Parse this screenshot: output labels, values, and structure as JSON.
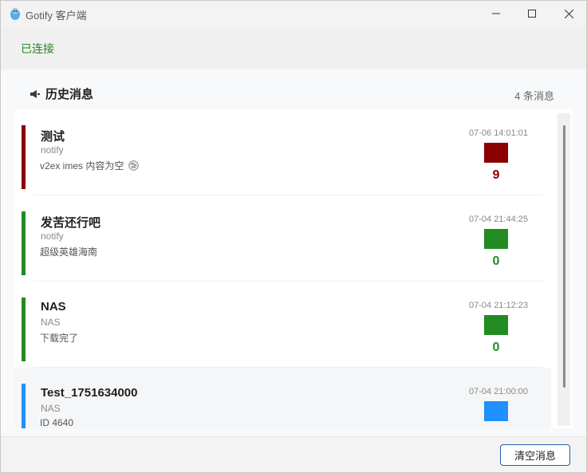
{
  "window": {
    "title": "Gotify 客户端"
  },
  "status": {
    "text": "已连接"
  },
  "section": {
    "title": "历史消息",
    "count": "4 条消息"
  },
  "messages": [
    {
      "title": "测试",
      "app": "notify",
      "body": "v2ex imes 内容为空",
      "body_icon": "globe-emoji-icon",
      "time": "07-06 14:01:01",
      "priority": "9",
      "color": "#8b0000"
    },
    {
      "title": "发苦还行吧",
      "app": "notify",
      "body": "超级英雄海南",
      "time": "07-04 21:44:25",
      "priority": "0",
      "color": "#228b22"
    },
    {
      "title": "NAS",
      "app": "NAS",
      "body": "下载完了",
      "time": "07-04 21:12:23",
      "priority": "0",
      "color": "#228b22"
    },
    {
      "title": "Test_1751634000",
      "app": "NAS",
      "body": "ID 4640",
      "time": "07-04 21:00:00",
      "priority": "",
      "color": "#1e90ff"
    }
  ],
  "footer": {
    "clear_label": "清空消息"
  }
}
